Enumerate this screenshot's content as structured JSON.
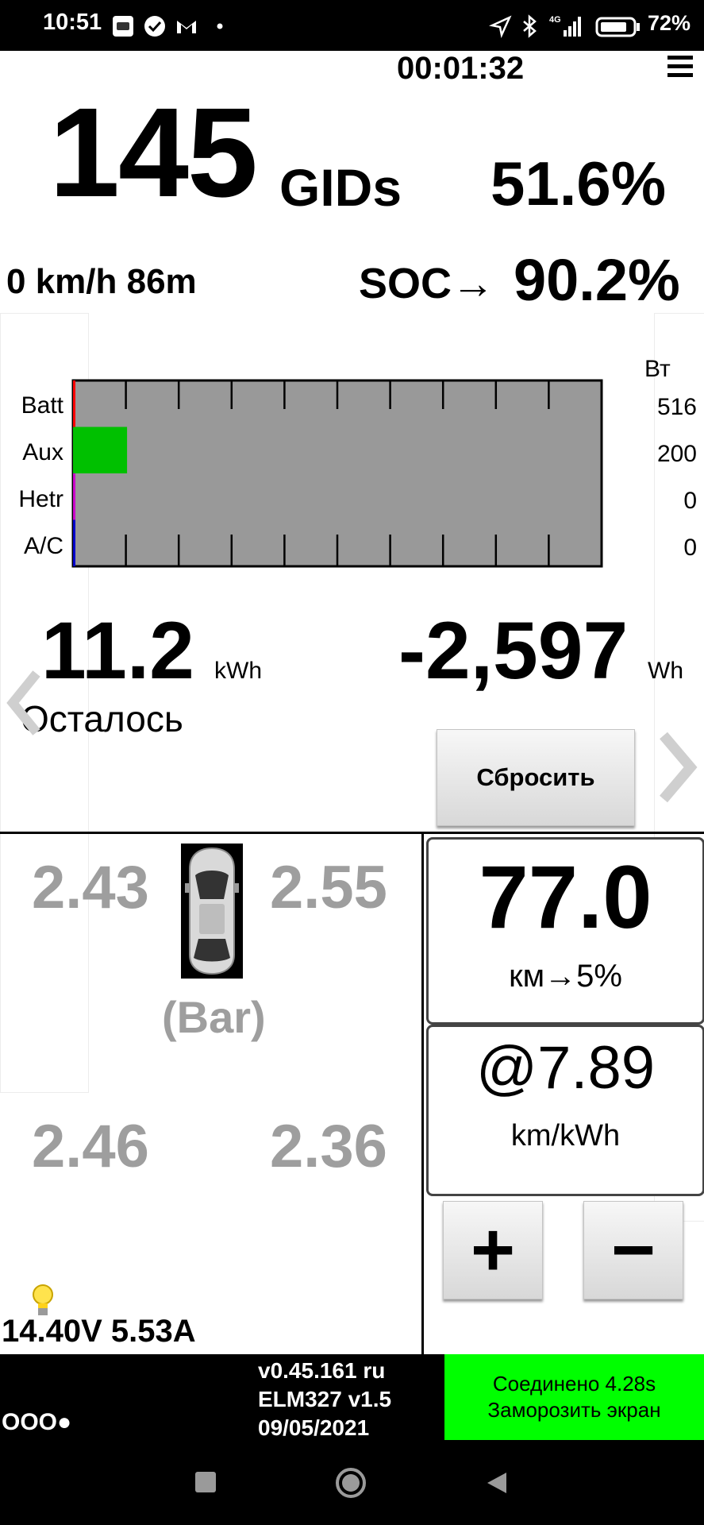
{
  "status_bar": {
    "time": "10:51",
    "icons": [
      "car-app-icon",
      "check-circle-icon",
      "gmail-icon",
      "dot-icon",
      "location-arrow-icon",
      "bluetooth-icon",
      "signal-4g-icon",
      "battery-icon"
    ],
    "battery": "72%"
  },
  "header": {
    "timer": "00:01:32",
    "menu_icon": "hamburger-menu-icon"
  },
  "gids": {
    "value": "145",
    "unit": "GIDs",
    "percent": "51.6%"
  },
  "drive": {
    "speed_altitude": "0 km/h 86m",
    "soc_label": "SOC→",
    "soc_value": "90.2%"
  },
  "power_chart": {
    "unit": "Вт",
    "rows": [
      {
        "label": "Batt",
        "value": "516",
        "fill_fraction": 0.0,
        "color": "#ff0000"
      },
      {
        "label": "Aux",
        "value": "200",
        "fill_fraction": 0.1,
        "color": "#00c000"
      },
      {
        "label": "Hetr",
        "value": "0",
        "fill_fraction": 0.0,
        "color": "#cc00cc"
      },
      {
        "label": "A/C",
        "value": "0",
        "fill_fraction": 0.0,
        "color": "#0000cc"
      }
    ]
  },
  "energy": {
    "remaining_value": "11.2",
    "remaining_unit": "kWh",
    "remaining_label": "Осталось",
    "used_value": "-2,597",
    "used_unit": "Wh",
    "reset_label": "Сбросить"
  },
  "tires": {
    "front_left": "2.43",
    "front_right": "2.55",
    "rear_left": "2.46",
    "rear_right": "2.36",
    "unit": "(Bar)"
  },
  "range": {
    "value": "77.0",
    "subtitle": "км→5%"
  },
  "efficiency": {
    "value": "@7.89",
    "unit": "km/kWh"
  },
  "adjust": {
    "plus": "+",
    "minus": "−"
  },
  "aux_battery": {
    "text": "14.40V 5.53A"
  },
  "footer": {
    "dots": "OOO●",
    "version_lines": [
      "v0.45.161 ru",
      "ELM327 v1.5",
      "09/05/2021"
    ],
    "connection": "Соединено 4.28s",
    "freeze": "Заморозить экран"
  },
  "colors": {
    "chart_bg": "#999999",
    "status_green": "#00ff00",
    "tire_gray": "#9e9e9e"
  }
}
